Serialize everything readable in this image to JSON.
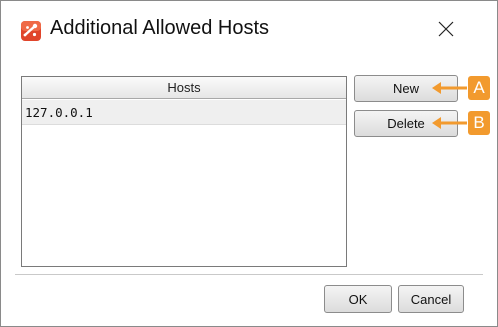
{
  "window": {
    "title": "Additional Allowed Hosts",
    "app_icon": "app-logo-icon",
    "close_icon": "close-icon"
  },
  "table": {
    "columns": [
      "Hosts"
    ],
    "rows": [
      [
        "127.0.0.1"
      ]
    ]
  },
  "side_buttons": {
    "new_label": "New",
    "delete_label": "Delete"
  },
  "annotations": {
    "a": "A",
    "b": "B",
    "color": "#f29a2e"
  },
  "footer": {
    "ok_label": "OK",
    "cancel_label": "Cancel"
  }
}
